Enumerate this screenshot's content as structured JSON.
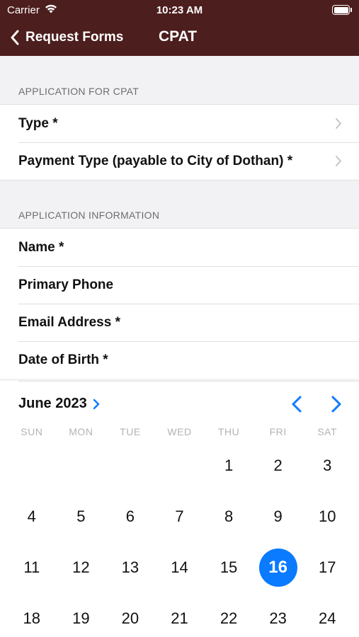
{
  "status_bar": {
    "carrier": "Carrier",
    "time": "10:23 AM"
  },
  "nav": {
    "back_label": "Request Forms",
    "title": "CPAT"
  },
  "colors": {
    "header_bg": "#4d1e1e",
    "accent": "#0a7aff"
  },
  "sections": [
    {
      "header": "APPLICATION FOR CPAT",
      "rows": [
        {
          "label": "Type *",
          "has_chevron": true
        },
        {
          "label": "Payment Type (payable to City of Dothan) *",
          "has_chevron": true
        }
      ]
    },
    {
      "header": "APPLICATION INFORMATION",
      "rows": [
        {
          "label": "Name *"
        },
        {
          "label": "Primary Phone"
        },
        {
          "label": "Email Address *"
        },
        {
          "label": "Date of Birth *"
        }
      ]
    }
  ],
  "calendar": {
    "month_label": "June 2023",
    "weekdays": [
      "SUN",
      "MON",
      "TUE",
      "WED",
      "THU",
      "FRI",
      "SAT"
    ],
    "first_weekday_index": 4,
    "days": [
      "1",
      "2",
      "3",
      "4",
      "5",
      "6",
      "7",
      "8",
      "9",
      "10",
      "11",
      "12",
      "13",
      "14",
      "15",
      "16",
      "17",
      "18",
      "19",
      "20",
      "21",
      "22",
      "23",
      "24"
    ],
    "selected_day": "16"
  }
}
